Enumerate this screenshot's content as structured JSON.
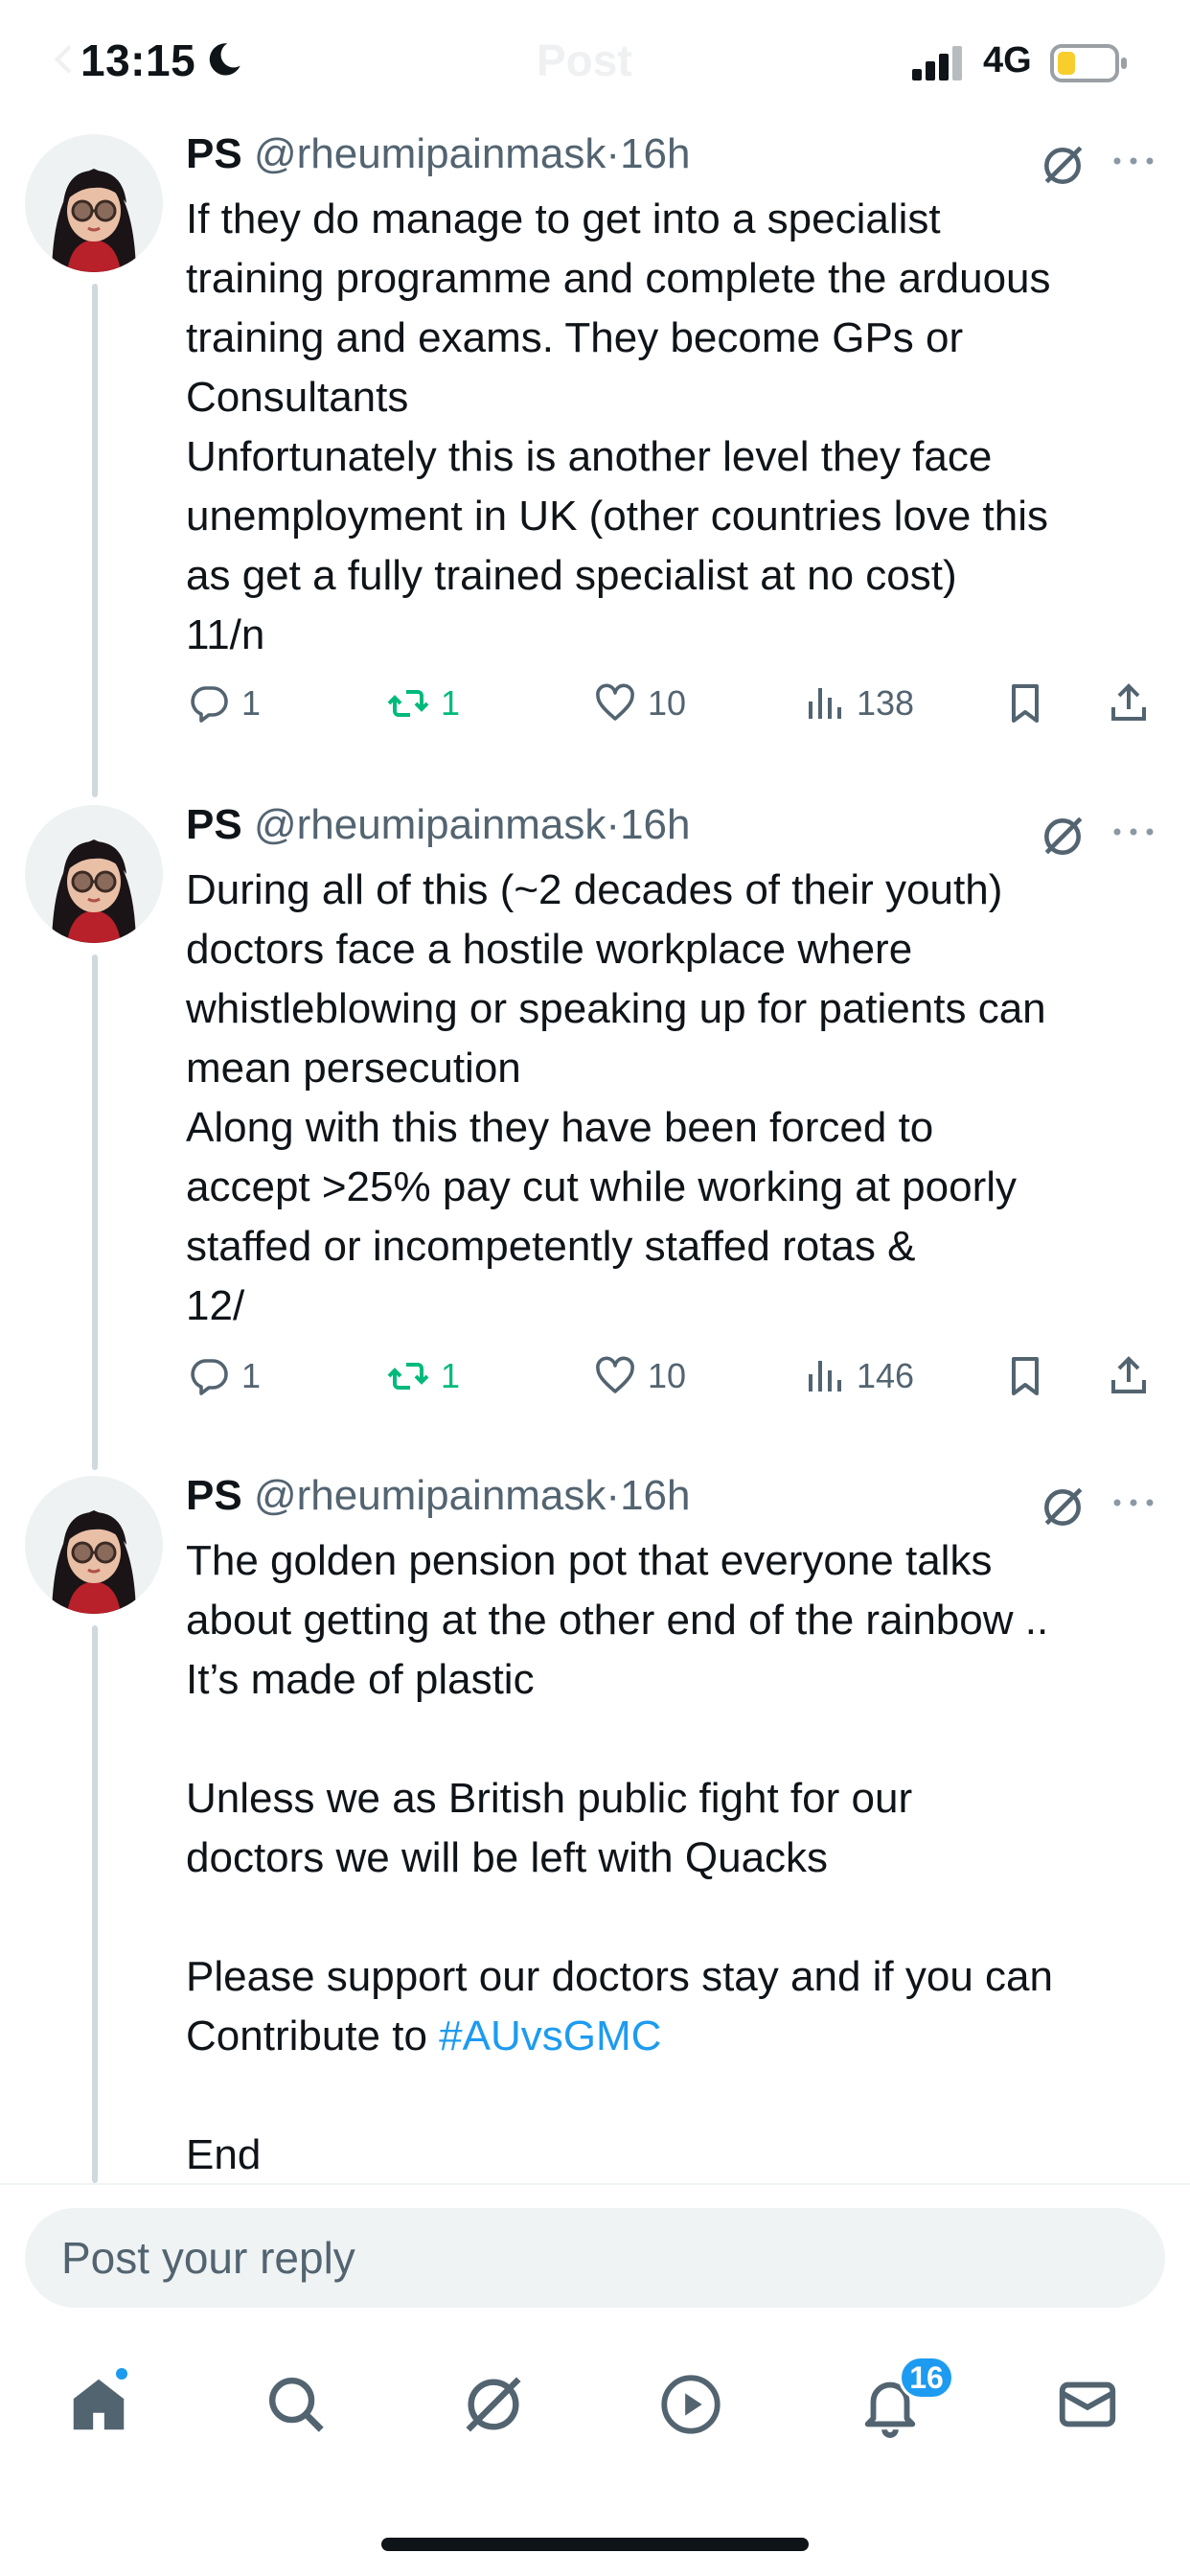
{
  "status_bar": {
    "time": "13:15",
    "network": "4G",
    "ghost_title": "Post"
  },
  "tweets": [
    {
      "name": "PS",
      "handle": "@rheumipainmask",
      "dot": "·",
      "time": "16h",
      "lines": [
        "If they do manage to get into a specialist",
        "training programme and complete the arduous",
        "training and exams. They become GPs or",
        "Consultants",
        "Unfortunately this is another level they face",
        "unemployment in UK (other countries love this",
        "as get a fully trained specialist at no cost)",
        "11/n"
      ],
      "stats": {
        "replies": "1",
        "reposts": "1",
        "likes": "10",
        "views": "138"
      }
    },
    {
      "name": "PS",
      "handle": "@rheumipainmask",
      "dot": "·",
      "time": "16h",
      "lines": [
        "During all of this (~2 decades of their youth)",
        "doctors face a hostile workplace where",
        "whistleblowing or speaking up for patients can",
        "mean persecution",
        "Along with this they have been forced to",
        "accept >25% pay cut while working at poorly",
        "staffed or incompetently staffed rotas &",
        "12/"
      ],
      "stats": {
        "replies": "1",
        "reposts": "1",
        "likes": "10",
        "views": "146"
      }
    },
    {
      "name": "PS",
      "handle": "@rheumipainmask",
      "dot": "·",
      "time": "16h",
      "lines": [
        "The golden pension pot that everyone talks",
        "about getting at the other end of the rainbow ..",
        "It’s made of plastic",
        "",
        "Unless we as British public fight for our",
        "doctors we will be left with Quacks",
        "",
        "Please support our doctors stay and if you can",
        "Contribute to",
        "",
        "End"
      ],
      "hashtag": "#AUvsGMC"
    }
  ],
  "reply": {
    "placeholder": "Post your reply"
  },
  "nav": {
    "notifications_badge": "16"
  },
  "colors": {
    "accent": "#1d9bf0",
    "repost_green": "#00ba7c",
    "secondary_text": "#536471",
    "thread_line": "#cfd9de"
  }
}
